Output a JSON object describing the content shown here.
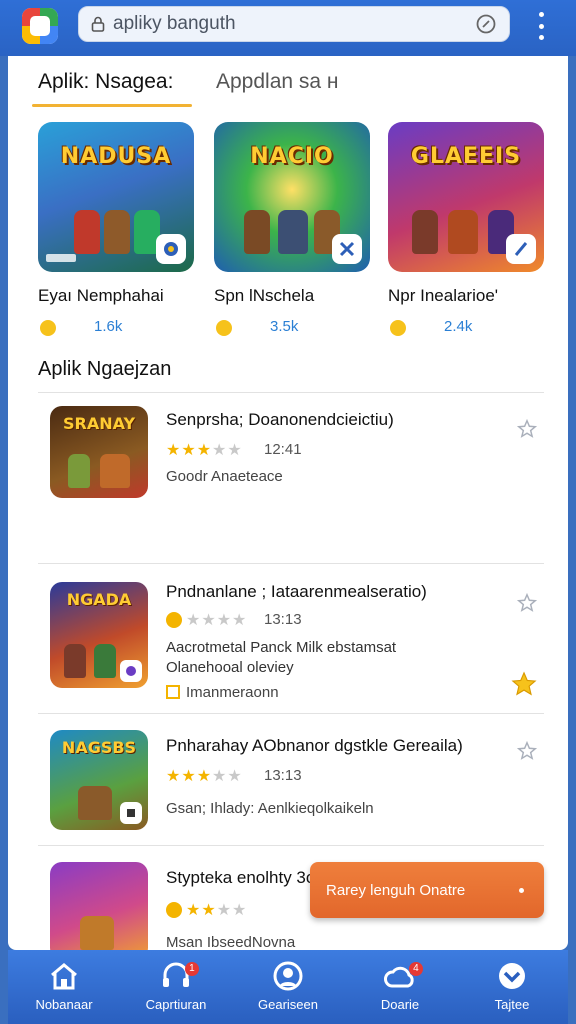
{
  "colors": {
    "top_bar": "#2f6fd6",
    "tab_underline": "#f2b233",
    "accent_blue": "#2a7fd4",
    "star": "#f4b400",
    "cta": "#e2672b",
    "bottom_nav": "#2a5fbf",
    "badge": "#e53935"
  },
  "header": {
    "logo_icon": "app-logo",
    "search_value": "apliky banguth",
    "search_icon": "lock-icon",
    "clear_icon": "refresh-icon",
    "menu_icon": "kebab-menu-icon"
  },
  "tabs": [
    {
      "label": "Aplik: Nsagea:",
      "active": true
    },
    {
      "label": "Appdlan sa н",
      "active": false
    }
  ],
  "featured": [
    {
      "art_title": "NADUSA",
      "name": "Eyaı Nemphahai",
      "count": "1.6k"
    },
    {
      "art_title": "NACIO",
      "name": "Spn lNschela",
      "count": "3.5k"
    },
    {
      "art_title": "GLAEEIS",
      "name": "Npr Inealarioe'",
      "count": "2.4k"
    }
  ],
  "section": {
    "title": "Aplik Ngaejzan"
  },
  "list": [
    {
      "art_title": "SRANAY",
      "title": "Senprsha; Doanonendcieictiu)",
      "rating": 3,
      "time": "12:41",
      "desc": [],
      "tag": "Goodr Anaeteace",
      "has_tag_box": false,
      "featured_star": false
    },
    {
      "art_title": "NGADA",
      "title": "Pndnanlane ; Iataarenmealseratio)",
      "rating": 0,
      "time": "13:13",
      "desc": [
        "Aacrotmetal Panck Milk ebstamsat",
        "Olanehooal oleviey"
      ],
      "tag": "Imanmeraonn",
      "has_tag_box": true,
      "featured_star": true
    },
    {
      "art_title": "NAGSBS",
      "title": "Pnharahay AObnanor dgstkle Gereaila)",
      "rating": 3,
      "time": "13:13",
      "desc": [],
      "tag": "Gsan; Ihlady: Aenlkieqolkaikeln",
      "has_tag_box": false,
      "featured_star": false
    },
    {
      "art_title": "",
      "title": "Stypteka enolhty 3odetdan",
      "rating": 2,
      "time": "",
      "desc": [],
      "tag": "Msan IbseedNovna",
      "has_tag_box": false,
      "featured_star": false
    }
  ],
  "cta": {
    "label": "Rarey lenguh Onatre"
  },
  "bottom_nav": [
    {
      "label": "Nobanaar",
      "icon": "home-icon",
      "badge": ""
    },
    {
      "label": "Caprtiuran",
      "icon": "headset-icon",
      "badge": "1"
    },
    {
      "label": "Geariseen",
      "icon": "profile-icon",
      "badge": ""
    },
    {
      "label": "Doarie",
      "icon": "cloud-icon",
      "badge": "4"
    },
    {
      "label": "Tajtee",
      "icon": "chevron-down-circle-icon",
      "badge": ""
    }
  ]
}
